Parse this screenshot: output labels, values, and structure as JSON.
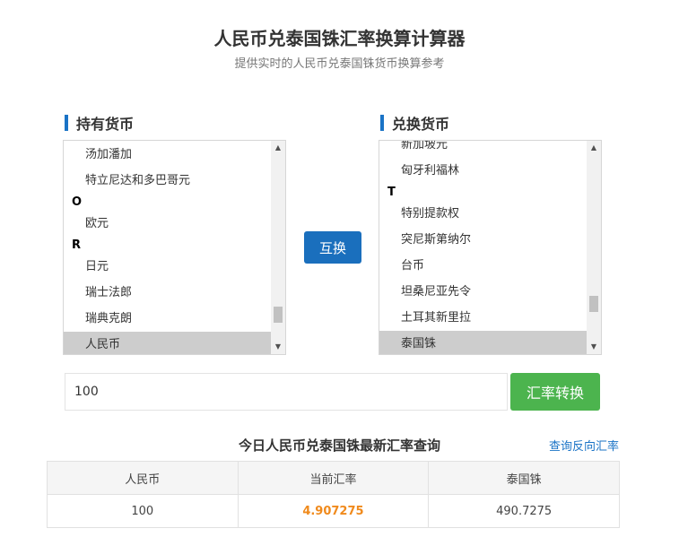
{
  "header": {
    "title": "人民币兑泰国铢汇率换算计算器",
    "subtitle": "提供实时的人民币兑泰国铢货币换算参考"
  },
  "from_section": {
    "label": "持有货币",
    "items": [
      {
        "type": "option",
        "label": "汤加潘加"
      },
      {
        "type": "option",
        "label": "特立尼达和多巴哥元"
      },
      {
        "type": "group",
        "label": "O"
      },
      {
        "type": "option",
        "label": "欧元"
      },
      {
        "type": "group",
        "label": "R"
      },
      {
        "type": "option",
        "label": "日元"
      },
      {
        "type": "option",
        "label": "瑞士法郎"
      },
      {
        "type": "option",
        "label": "瑞典克朗"
      },
      {
        "type": "option",
        "label": "人民币",
        "selected": true
      }
    ]
  },
  "to_section": {
    "label": "兑换货币",
    "items": [
      {
        "type": "option",
        "label": "新加坡元"
      },
      {
        "type": "option",
        "label": "匈牙利福林"
      },
      {
        "type": "group",
        "label": "T"
      },
      {
        "type": "option",
        "label": "特别提款权"
      },
      {
        "type": "option",
        "label": "突尼斯第纳尔"
      },
      {
        "type": "option",
        "label": "台币"
      },
      {
        "type": "option",
        "label": "坦桑尼亚先令"
      },
      {
        "type": "option",
        "label": "土耳其新里拉"
      },
      {
        "type": "option",
        "label": "泰国铢",
        "selected": true
      }
    ]
  },
  "swap_button": {
    "label": "互换"
  },
  "amount_input": {
    "value": "100"
  },
  "convert_button": {
    "label": "汇率转换"
  },
  "rate_section": {
    "title": "今日人民币兑泰国铢最新汇率查询",
    "reverse_link": "查询反向汇率",
    "headers": [
      "人民币",
      "当前汇率",
      "泰国铢"
    ],
    "row": [
      "100",
      "4.907275",
      "490.7275"
    ]
  },
  "colors": {
    "accent_blue": "#1a6fbd",
    "convert_green": "#4cb44e",
    "rate_orange": "#f08a1c"
  }
}
